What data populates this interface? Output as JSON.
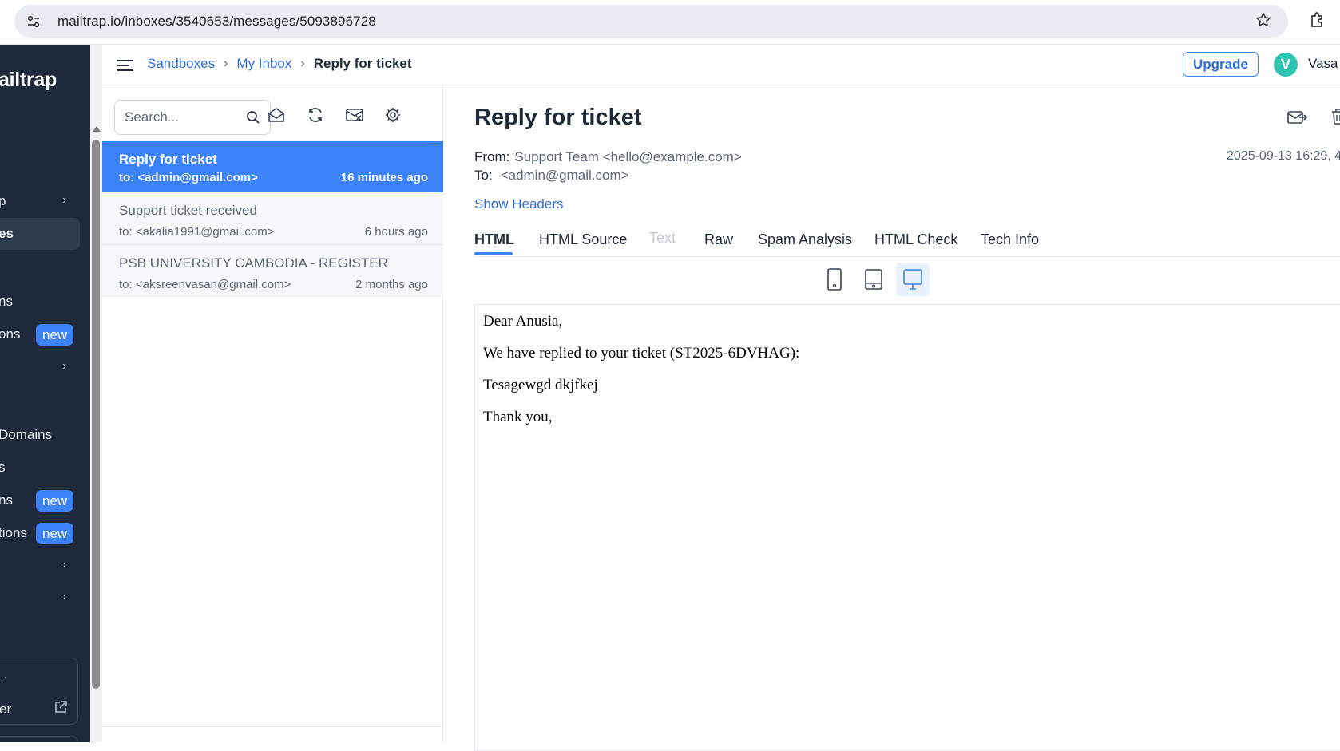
{
  "browser": {
    "url": "mailtrap.io/inboxes/3540653/messages/5093896728"
  },
  "sidebar": {
    "logo": "ailtrap",
    "items": [
      {
        "label": "p",
        "chevron": "›"
      },
      {
        "label": "es"
      },
      {
        "label": "ns"
      },
      {
        "label": "ons",
        "badge": "new"
      },
      {
        "label": "",
        "chevron": "›"
      },
      {
        "label": "Domains"
      },
      {
        "label": "s"
      },
      {
        "label": "ns",
        "badge": "new"
      },
      {
        "label": "tions",
        "badge": "new"
      },
      {
        "label": "",
        "chevron": "›"
      },
      {
        "label": "",
        "chevron": "›"
      }
    ],
    "card_dots": "...",
    "card_label": "er"
  },
  "topbar": {
    "breadcrumb": [
      "Sandboxes",
      "My Inbox",
      "Reply for ticket"
    ],
    "upgrade": "Upgrade",
    "avatar_letter": "V",
    "user_name": "Vasa"
  },
  "inbox": {
    "search_placeholder": "Search...",
    "messages": [
      {
        "subject": "Reply for ticket",
        "to": "to: <admin@gmail.com>",
        "ago": "16 minutes ago",
        "selected": true
      },
      {
        "subject": "Support ticket received",
        "to": "to: <akalia1991@gmail.com>",
        "ago": "6 hours ago",
        "selected": false
      },
      {
        "subject": "PSB UNIVERSITY CAMBODIA - REGISTER",
        "to": "to: <aksreenvasan@gmail.com>",
        "ago": "2 months ago",
        "selected": false
      }
    ]
  },
  "message": {
    "subject": "Reply for ticket",
    "from_label": "From:",
    "from_value": "Support Team <hello@example.com>",
    "to_label": "To:",
    "to_value": "<admin@gmail.com>",
    "date": "2025-09-13 16:29, 4",
    "show_headers": "Show Headers",
    "tabs": [
      "HTML",
      "HTML Source",
      "Text",
      "Raw",
      "Spam Analysis",
      "HTML Check",
      "Tech Info"
    ],
    "active_tab": "HTML",
    "body": [
      "Dear Anusia,",
      "We have replied to your ticket (ST2025-6DVHAG):",
      "Tesagewgd dkjfkej",
      "Thank you,"
    ]
  },
  "colors": {
    "accent": "#3b82f6",
    "sidebar_bg": "#1e2a3b",
    "link": "#2f6fdc"
  }
}
